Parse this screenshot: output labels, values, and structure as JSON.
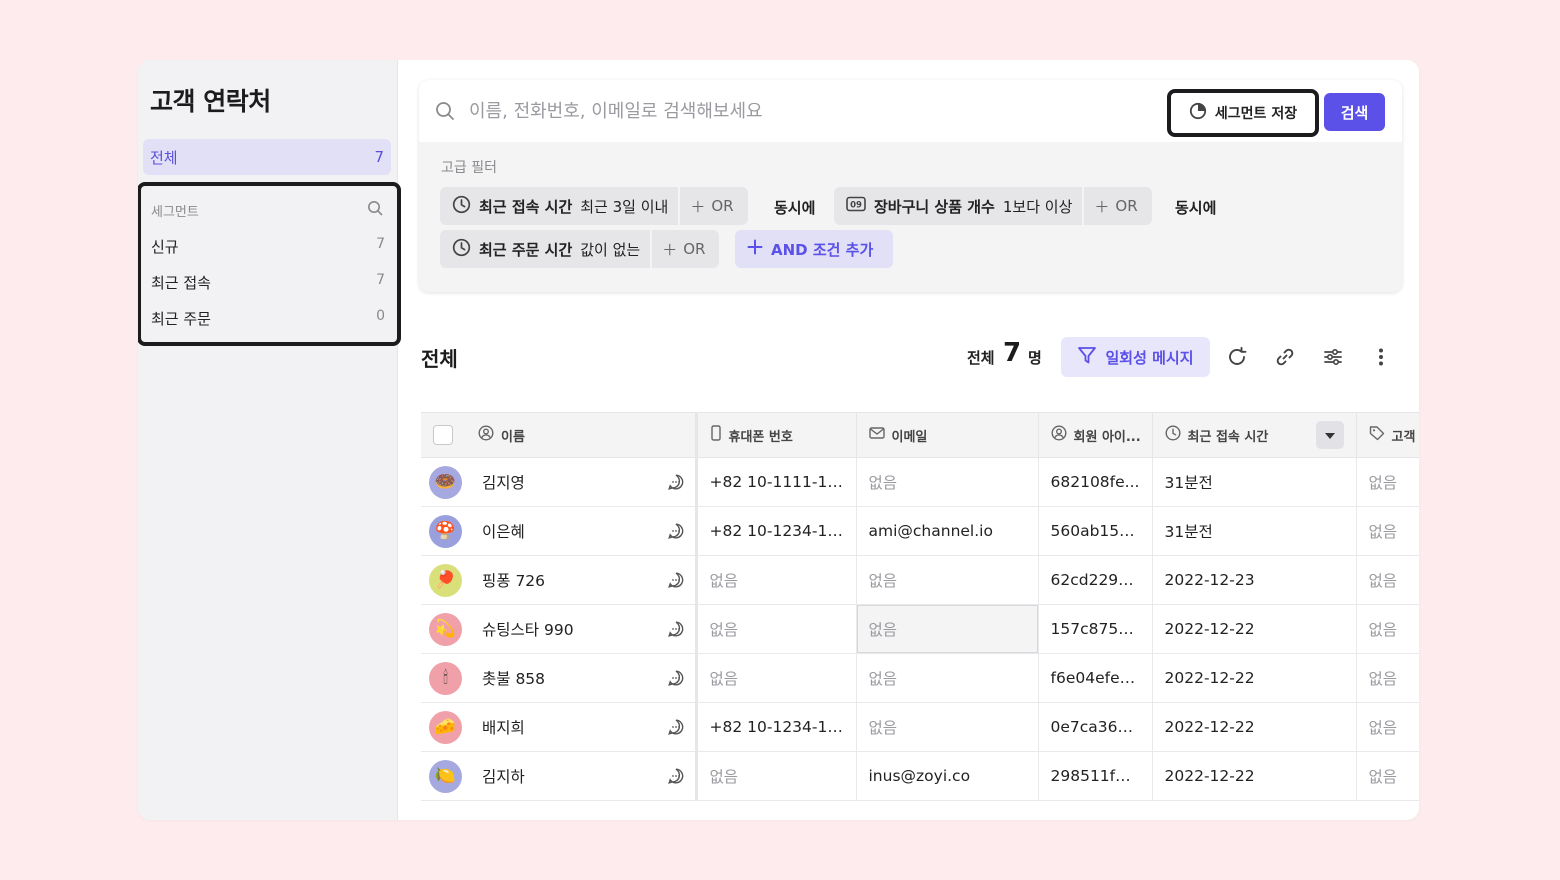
{
  "sidebar": {
    "title": "고객 연락처",
    "all": {
      "label": "전체",
      "count": "7"
    },
    "segments_header": "세그먼트",
    "segments": [
      {
        "label": "신규",
        "count": "7"
      },
      {
        "label": "최근 접속",
        "count": "7"
      },
      {
        "label": "최근 주문",
        "count": "0"
      }
    ]
  },
  "search": {
    "placeholder": "이름, 전화번호, 이메일로 검색해보세요",
    "save_segment_label": "세그먼트 저장",
    "search_button": "검색"
  },
  "filters": {
    "label": "고급 필터",
    "conditions": [
      {
        "name": "최근 접속 시간",
        "value": "최근 3일 이내",
        "icon": "clock-icon"
      },
      {
        "name": "장바구니 상품 개수",
        "value": "1보다 이상",
        "icon": "number-icon",
        "icon_text": "09"
      },
      {
        "name": "최근 주문 시간",
        "value": "값이 없는",
        "icon": "clock-icon"
      }
    ],
    "or_label": "OR",
    "and_joiner": "동시에",
    "add_and_label": "AND 조건 추가"
  },
  "list": {
    "title": "전체",
    "total_label": "전체",
    "total_count": "7",
    "total_unit": "명",
    "oneoff_message": "일회성 메시지"
  },
  "table": {
    "headers": [
      "이름",
      "휴대폰 번호",
      "이메일",
      "회원 아이...",
      "최근 접속 시간",
      "고객"
    ],
    "rows": [
      {
        "name": "김지영",
        "avatar": "🍩",
        "avatar_bg": "#a6a8e0",
        "phone": "+82 10-1111-1111",
        "email": "없음",
        "member_id": "682108fe...",
        "last_access": "31분전",
        "tag": "없음"
      },
      {
        "name": "이은혜",
        "avatar": "🍄",
        "avatar_bg": "#9aa0de",
        "phone": "+82 10-1234-12...",
        "email": "ami@channel.io",
        "member_id": "560ab154...",
        "last_access": "31분전",
        "tag": "없음"
      },
      {
        "name": "핑퐁 726",
        "avatar": "🏓",
        "avatar_bg": "#d9e07a",
        "phone": "없음",
        "email": "없음",
        "member_id": "62cd2297...",
        "last_access": "2022-12-23",
        "tag": "없음"
      },
      {
        "name": "슈팅스타 990",
        "avatar": "💫",
        "avatar_bg": "#f0a0a8",
        "phone": "없음",
        "email": "없음",
        "member_id": "157c875d...",
        "last_access": "2022-12-22",
        "tag": "없음"
      },
      {
        "name": "촛불 858",
        "avatar": "🕯",
        "avatar_bg": "#f0a0a8",
        "phone": "없음",
        "email": "없음",
        "member_id": "f6e04efe-...",
        "last_access": "2022-12-22",
        "tag": "없음"
      },
      {
        "name": "배지희",
        "avatar": "🧀",
        "avatar_bg": "#f0a0a8",
        "phone": "+82 10-1234-12...",
        "email": "없음",
        "member_id": "0e7ca361...",
        "last_access": "2022-12-22",
        "tag": "없음"
      },
      {
        "name": "김지하",
        "avatar": "🍋",
        "avatar_bg": "#a6a8e0",
        "phone": "없음",
        "email": "inus@zoyi.co",
        "member_id": "298511fb...",
        "last_access": "2022-12-22",
        "tag": "없음"
      }
    ]
  },
  "colors": {
    "accent": "#5b50e8",
    "accent_soft": "#e2e0f6",
    "empty_text": "#9a9aa0"
  }
}
